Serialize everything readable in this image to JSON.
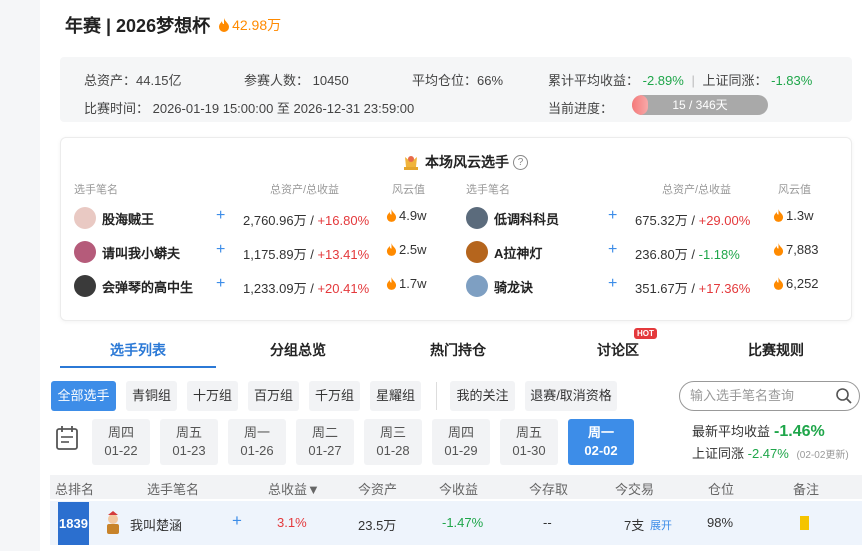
{
  "header": {
    "title": "年赛 | 2026梦想杯",
    "heat": "42.98万"
  },
  "summary": {
    "total_assets": "总资产：44.15亿",
    "participants": "参赛人数：  10450",
    "avg_position": "平均仓位：66%",
    "avg_return_label": "累计平均收益：",
    "avg_return_value": "-2.89%",
    "sep": "|",
    "sh_label": "上证同涨：",
    "sh_value": "-1.83%",
    "period": "比赛时间：  2026-01-19 15:00:00 至 2026-12-31 23:59:00",
    "progress_label": "当前进度：",
    "progress_text": "15 / 346天",
    "progress_fraction": 0.0434
  },
  "stars": {
    "title": "本场风云选手",
    "help": "?",
    "headers": {
      "name": "选手笔名",
      "assets": "总资产/总收益",
      "fyz": "风云值"
    },
    "left": [
      {
        "name": "股海贼王",
        "assets": "2,760.96万 / ",
        "ret": "+16.80%",
        "fyz": "4.9w",
        "avatar_color": "#e9c9c3"
      },
      {
        "name": "请叫我小蟒夫",
        "assets": "1,175.89万 / ",
        "ret": "+13.41%",
        "fyz": "2.5w",
        "avatar_color": "#b55b7a"
      },
      {
        "name": "会弹琴的高中生",
        "assets": "1,233.09万 / ",
        "ret": "+20.41%",
        "fyz": "1.7w",
        "avatar_color": "#3a3a3a"
      }
    ],
    "right": [
      {
        "name": "低调科科员",
        "assets": "675.32万 / ",
        "ret": "+29.00%",
        "ret_color": "red",
        "fyz": "1.3w",
        "avatar_color": "#5b6b7c"
      },
      {
        "name": "A拉神灯",
        "assets": "236.80万 / ",
        "ret": "-1.18%",
        "ret_color": "green",
        "fyz": "7,883",
        "avatar_color": "#b5651d"
      },
      {
        "name": "骑龙诀",
        "assets": "351.67万 / ",
        "ret": "+17.36%",
        "ret_color": "red",
        "fyz": "6,252",
        "avatar_color": "#7e9fc2"
      }
    ]
  },
  "tabs": [
    "选手列表",
    "分组总览",
    "热门持仓",
    "讨论区",
    "比赛规则"
  ],
  "hot_badge": "HOT",
  "filters": [
    "全部选手",
    "青铜组",
    "十万组",
    "百万组",
    "千万组",
    "星耀组",
    "我的关注",
    "退赛/取消资格"
  ],
  "search": {
    "placeholder": "输入选手笔名查询"
  },
  "dates": [
    {
      "day": "周四",
      "date": "01-22"
    },
    {
      "day": "周五",
      "date": "01-23"
    },
    {
      "day": "周一",
      "date": "01-26"
    },
    {
      "day": "周二",
      "date": "01-27"
    },
    {
      "day": "周三",
      "date": "01-28"
    },
    {
      "day": "周四",
      "date": "01-29"
    },
    {
      "day": "周五",
      "date": "01-30"
    },
    {
      "day": "周一",
      "date": "02-02"
    }
  ],
  "stats": {
    "latest_label": "最新平均收益",
    "latest_value": "-1.46%",
    "sh_label": "上证同涨",
    "sh_value": "-2.47%",
    "sh_note": "(02-02更新)"
  },
  "table": {
    "headers": [
      "总排名",
      "选手笔名",
      "总收益▼",
      "今资产",
      "今收益",
      "今存取",
      "今交易",
      "仓位",
      "备注"
    ],
    "rows": [
      {
        "rank": "1839",
        "name": "我叫楚涵",
        "plus": "+",
        "total_return": "3.1%",
        "assets": "23.5万",
        "today_return": "-1.47%",
        "cash": "--",
        "trades": "7支",
        "expand": "展开",
        "position": "98%"
      }
    ]
  },
  "colors": {
    "accent": "#3d8de8",
    "up": "#e4393c",
    "down": "#1fa64a",
    "heat": "#ff8a00"
  }
}
